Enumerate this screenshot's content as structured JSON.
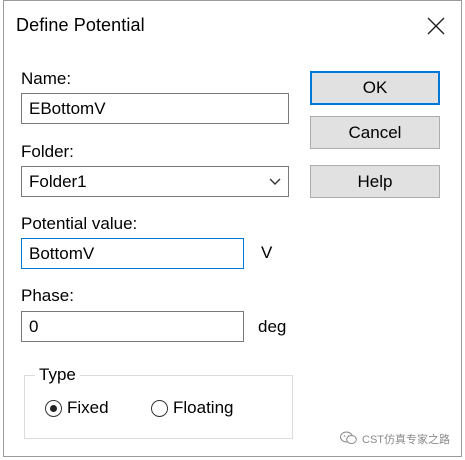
{
  "dialog": {
    "title": "Define Potential"
  },
  "name": {
    "label": "Name:",
    "value": "EBottomV"
  },
  "folder": {
    "label": "Folder:",
    "value": "Folder1"
  },
  "potential": {
    "label": "Potential value:",
    "value": "BottomV",
    "unit": "V"
  },
  "phase": {
    "label": "Phase:",
    "value": "0",
    "unit": "deg"
  },
  "type": {
    "legend": "Type",
    "options": [
      {
        "label": "Fixed",
        "selected": true
      },
      {
        "label": "Floating",
        "selected": false
      }
    ]
  },
  "buttons": {
    "ok": "OK",
    "cancel": "Cancel",
    "help": "Help"
  },
  "watermark": {
    "text": "CST仿真专家之路"
  },
  "colors": {
    "accent": "#0078d7",
    "button_face": "#e1e1e1"
  }
}
